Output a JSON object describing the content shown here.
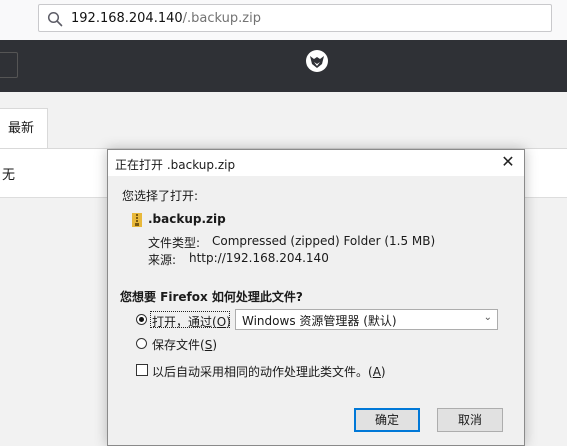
{
  "urlbar": {
    "host": "192.168.204.140",
    "path": "/.backup.zip"
  },
  "tabs": {
    "active_label": "最新"
  },
  "content": {
    "cell_text": "无"
  },
  "dialog": {
    "title": "正在打开 .backup.zip",
    "intro": "您选择了打开:",
    "file_name": ".backup.zip",
    "file_type_label": "文件类型:",
    "file_type_value": "Compressed (zipped) Folder (1.5 MB)",
    "source_label": "来源:",
    "source_value": "http://192.168.204.140",
    "question": "您想要 Firefox 如何处理此文件?",
    "open_with_label": "打开，通过(",
    "open_with_key": "O",
    "open_with_close": ")",
    "open_with_app": "Windows 资源管理器 (默认)",
    "save_label": "保存文件(",
    "save_key": "S",
    "save_close": ")",
    "remember_label": "以后自动采用相同的动作处理此类文件。(",
    "remember_key": "A",
    "remember_close": ")",
    "ok_label": "确定",
    "cancel_label": "取消",
    "close_glyph": "✕"
  },
  "colors": {
    "toolbar_dark": "#2f3136",
    "focus_blue": "#0078d7",
    "file_icon_yellow": "#e8b83a"
  }
}
